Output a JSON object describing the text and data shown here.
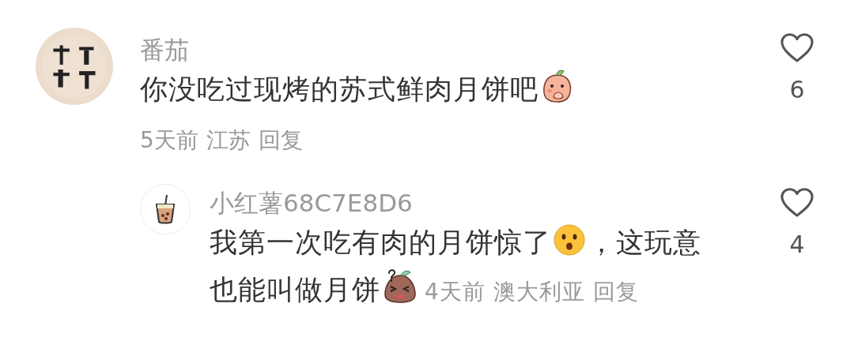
{
  "comments": [
    {
      "author": "番茄",
      "avatar": {
        "kind": "picture"
      },
      "content": [
        {
          "kind": "text",
          "text": "你没吃过现烤的苏式鲜肉月饼吧"
        },
        {
          "kind": "peach"
        }
      ],
      "time": "5天前",
      "location": "江苏",
      "reply_label": "回复",
      "liked": false,
      "likes": "6",
      "replies": [
        {
          "author": "小红薯68C7E8D6",
          "avatar": {
            "kind": "bubble-tea"
          },
          "content": [
            {
              "kind": "text",
              "text": "我第一次吃有肉的月饼惊了"
            },
            {
              "kind": "worried"
            },
            {
              "kind": "text",
              "text": "，这玩意"
            },
            {
              "kind": "text",
              "text": "也能叫做月饼"
            },
            {
              "kind": "potato"
            }
          ],
          "time": "4天前",
          "location": "澳大利亚",
          "reply_label": "回复",
          "liked": false,
          "likes": "4"
        }
      ]
    }
  ]
}
